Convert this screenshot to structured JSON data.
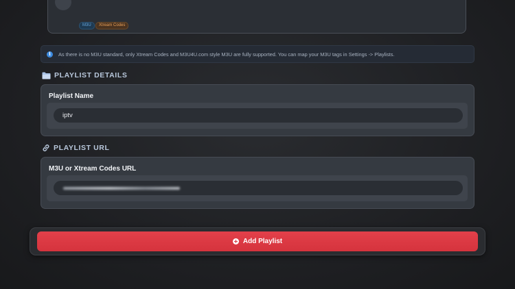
{
  "top_card": {
    "badges": [
      "M3U",
      "Xtream Codes"
    ]
  },
  "info": {
    "text": "As there is no M3U standard, only Xtream Codes and M3U4U.com style M3U are fully supported. You can map your M3U tags in Settings -> Playlists.",
    "icon": "info-icon"
  },
  "sections": {
    "details": {
      "title": "PLAYLIST DETAILS",
      "icon": "folder-icon"
    },
    "url": {
      "title": "PLAYLIST URL",
      "icon": "link-icon"
    }
  },
  "fields": {
    "name": {
      "label": "Playlist Name",
      "value": "iptv"
    },
    "url": {
      "label": "M3U or Xtream Codes URL"
    }
  },
  "actions": {
    "add_label": "Add Playlist",
    "add_icon": "plus-circle-icon"
  },
  "colors": {
    "accent": "#d5333d",
    "info_icon": "#3d8be0",
    "section_title": "#b9c8dc"
  }
}
